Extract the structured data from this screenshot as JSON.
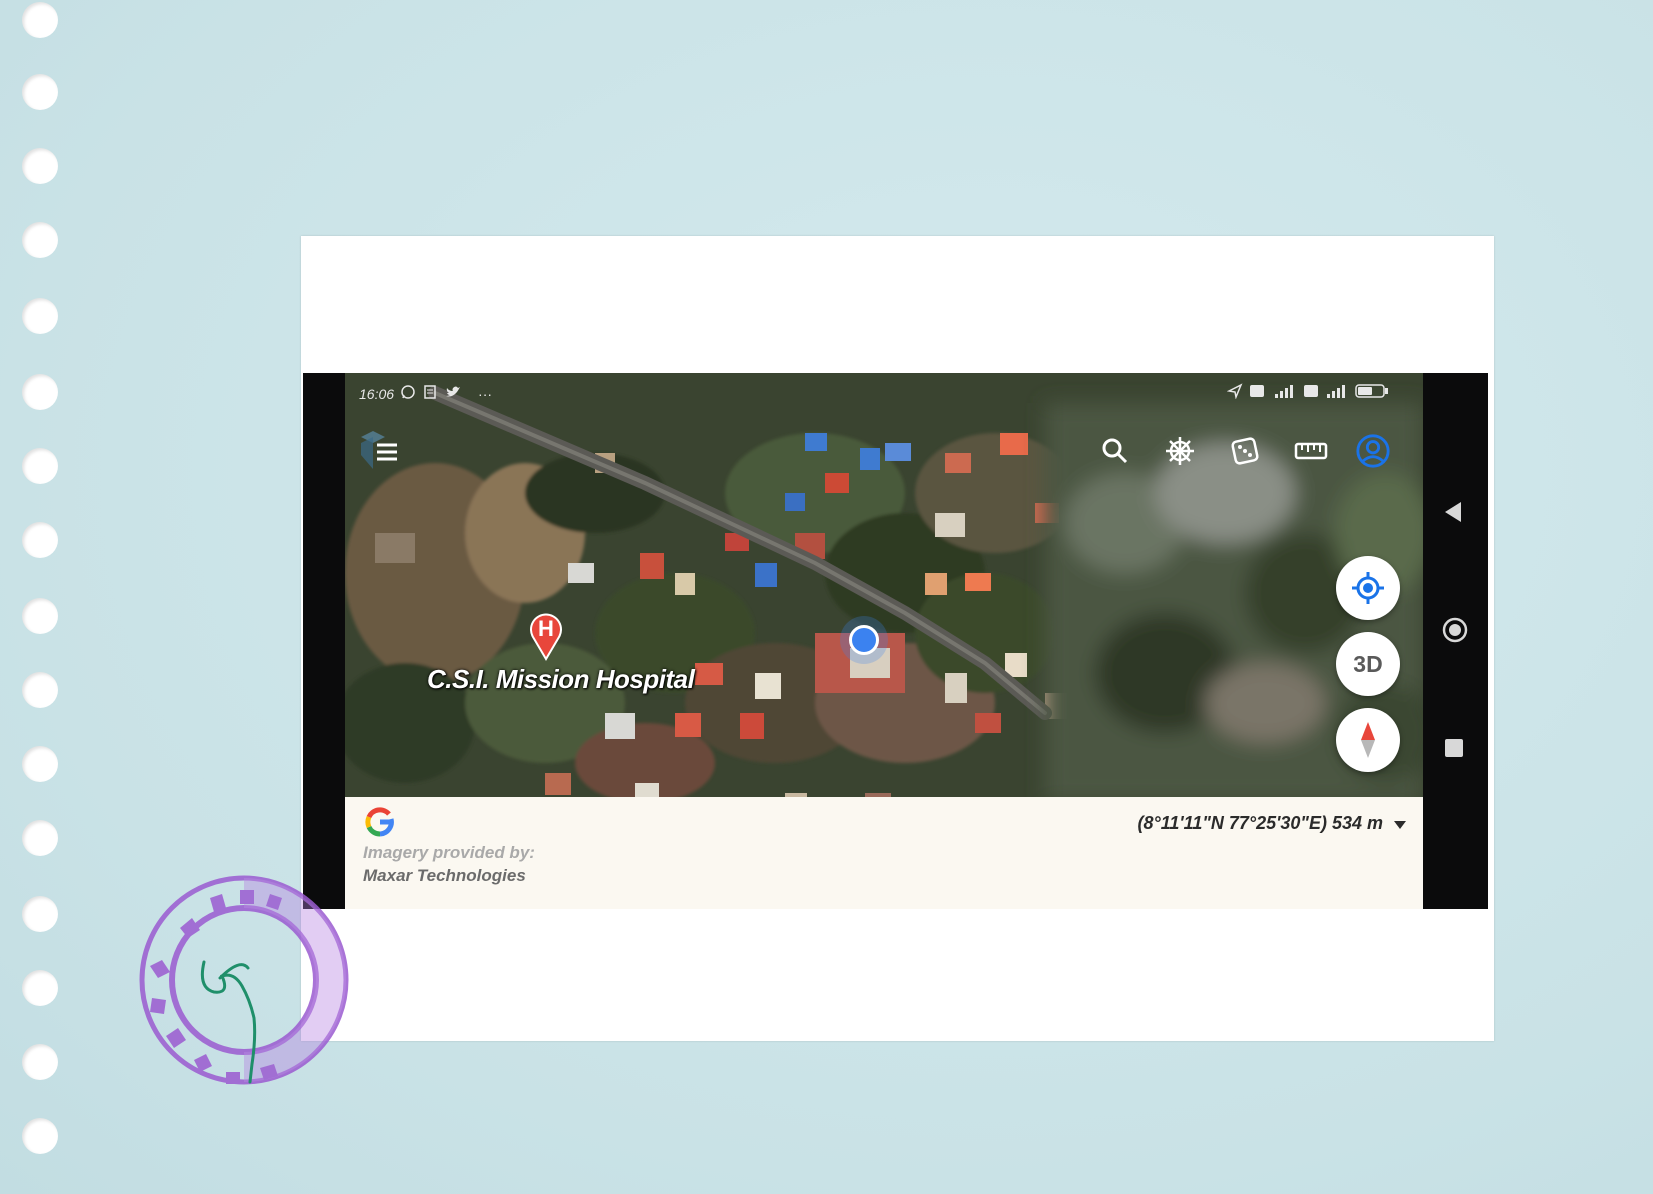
{
  "status_bar": {
    "time": "16:06",
    "icons_left": [
      "whatsapp-icon",
      "note-icon",
      "twitter-icon",
      "more-dots-icon"
    ],
    "icons_right": [
      "location-arrow-icon",
      "volte-icon",
      "signal-4g-icon",
      "volte-icon",
      "signal-icon",
      "battery-icon"
    ],
    "more": "···"
  },
  "toolbar": {
    "icons": [
      "search-icon",
      "ship-wheel-icon",
      "dice-icon",
      "ruler-icon",
      "account-icon"
    ]
  },
  "map": {
    "place_label": "C.S.I. Mission Hospital",
    "pin_letter": "H",
    "pin_color": "#e8463b",
    "location_dot_color": "#3b82f0"
  },
  "fabs": {
    "my_location_icon": "crosshair-icon",
    "three_d_label": "3D",
    "compass_icon": "compass-icon"
  },
  "footer": {
    "logo": "google-logo",
    "imagery_label": "Imagery provided by:",
    "imagery_provider": "Maxar Technologies",
    "coordinates": "(8°11'11\"N 77°25'30\"E) 534 m"
  },
  "nav_bar": {
    "buttons": [
      "back-icon",
      "home-icon",
      "recents-icon"
    ]
  },
  "colors": {
    "accent": "#1a73e8",
    "stamp": "#9b5bd1",
    "signature": "#1f8f6a",
    "page_bg": "#cfe6ea"
  }
}
